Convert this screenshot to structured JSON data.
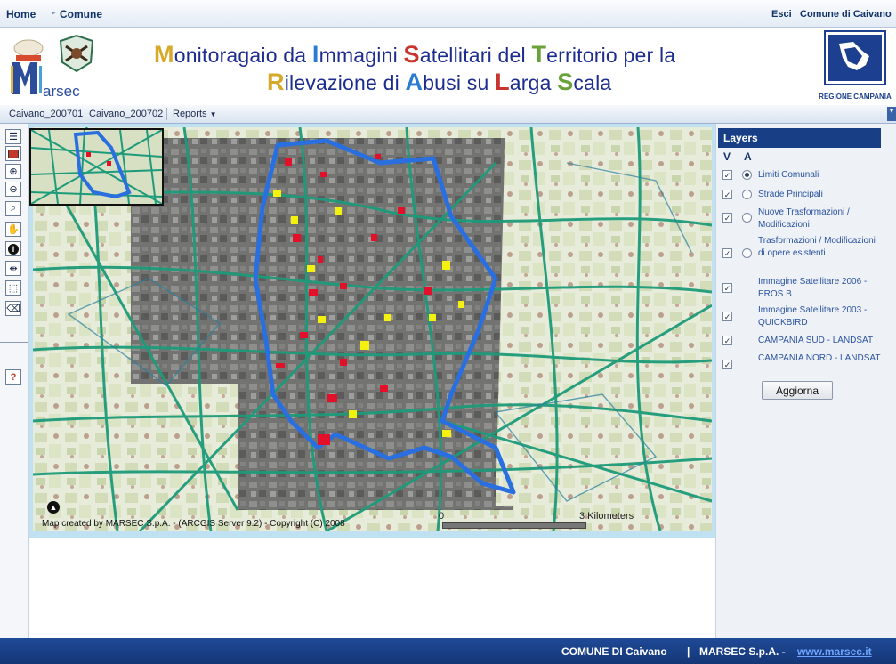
{
  "topnav": {
    "home": "Home",
    "comune": "Comune",
    "esci": "Esci",
    "comune_name": "Comune di Caivano"
  },
  "banner": {
    "line1": [
      {
        "cap": "M",
        "rest": "onitoragaio da ",
        "color": "#d6a92a"
      },
      {
        "cap": "I",
        "rest": "mmagini ",
        "color": "#2b7bd0"
      },
      {
        "cap": "S",
        "rest": "atellitari del ",
        "color": "#c8352e"
      },
      {
        "cap": "T",
        "rest": "erritorio per la",
        "color": "#6aa23a"
      }
    ],
    "line2": [
      {
        "cap": "R",
        "rest": "ilevazione di ",
        "color": "#d6a92a"
      },
      {
        "cap": "A",
        "rest": "busi su ",
        "color": "#2b7bd0"
      },
      {
        "cap": "L",
        "rest": "arga ",
        "color": "#c8352e"
      },
      {
        "cap": "S",
        "rest": "cala",
        "color": "#6aa23a"
      }
    ],
    "logo_left": "Marsec",
    "logo_right": "REGIONE CAMPANIA"
  },
  "toolbar": {
    "tab1": "Caivano_200701",
    "tab2": "Caivano_200702",
    "reports": "Reports"
  },
  "tools": [
    {
      "icon": "table-of-contents-icon"
    },
    {
      "icon": "overview-map-icon"
    },
    {
      "icon": "zoom-in-icon"
    },
    {
      "icon": "zoom-out-icon"
    },
    {
      "icon": "full-extent-icon"
    },
    {
      "icon": "pan-hand-icon"
    },
    {
      "icon": "identify-icon"
    },
    {
      "icon": "measure-icon"
    },
    {
      "icon": "select-icon"
    },
    {
      "icon": "eraser-icon"
    },
    {
      "icon": "help-icon"
    }
  ],
  "map": {
    "copyright": "Map created by MARSEC S.p.A. - (ARCGIS Server 9.2) - Copyright (C) 2008",
    "scale_start": "0",
    "scale_end": "3 Kilometers"
  },
  "layers": {
    "title": "Layers",
    "col_v": "V",
    "col_a": "A",
    "items": [
      {
        "name": "Limiti Comunali",
        "visible": true,
        "active": true
      },
      {
        "name": "Strade Principali",
        "visible": true,
        "active": false
      },
      {
        "name": "Nuove Trasformazioni / Modificazioni",
        "visible": true,
        "active": false
      },
      {
        "name": "Trasformazioni / Modificazioni di opere esistenti",
        "visible": true,
        "active": false
      },
      {
        "name": "Immagine Satellitare 2006 - EROS B",
        "visible": true,
        "active": null
      },
      {
        "name": "Immagine Satellitare 2003 - QUICKBIRD",
        "visible": true,
        "active": null
      },
      {
        "name": "CAMPANIA SUD - LANDSAT",
        "visible": true,
        "active": null
      },
      {
        "name": "CAMPANIA NORD - LANDSAT",
        "visible": true,
        "active": null
      }
    ],
    "button": "Aggiorna"
  },
  "footer": {
    "comune": "COMUNE DI Caivano",
    "sep": "|",
    "marsec": "MARSEC S.p.A. -",
    "link": "www.marsec.it"
  }
}
